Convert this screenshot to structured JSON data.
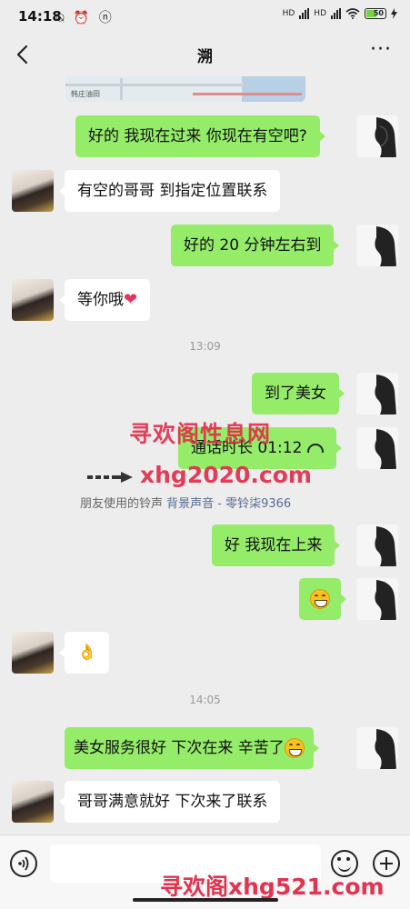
{
  "status_bar": {
    "time": "14:18",
    "battery": "50",
    "left_icons": "⍉ ⏰ ⓝ",
    "network": "HD"
  },
  "nav": {
    "title": "溯",
    "more": "···"
  },
  "map": {
    "label": "韩庄油田"
  },
  "messages": [
    {
      "side": "me",
      "text": "好的 我现在过来 你现在有空吧?"
    },
    {
      "side": "other",
      "text": "有空的哥哥 到指定位置联系"
    },
    {
      "side": "me",
      "text": "好的 20 分钟左右到"
    },
    {
      "side": "other",
      "text": "等你哦",
      "emoji": "❤"
    },
    {
      "side": "me",
      "text": "到了美女"
    },
    {
      "side": "me",
      "text": "通话时长 01:12"
    },
    {
      "side": "me",
      "text": "好 我现在上来"
    },
    {
      "side": "me",
      "text": ""
    },
    {
      "side": "other",
      "text": "👌"
    },
    {
      "side": "me",
      "text": "美女服务很好 下次在来 辛苦了"
    },
    {
      "side": "other",
      "text": "哥哥满意就好 下次来了联系"
    }
  ],
  "timestamps": [
    "13:09",
    "14:05"
  ],
  "ringtone": {
    "prefix": "朋友使用的铃声",
    "link": "背景声音 - 零铃柒9366"
  },
  "watermarks": [
    "寻欢阁性息网",
    "xhg2020.com",
    "寻欢阁xhg521.com"
  ],
  "colors": {
    "my_bubble": "#95ec69",
    "other_bubble": "#ffffff",
    "background": "#ededed",
    "watermark": "#e02846",
    "link": "#576b95"
  }
}
